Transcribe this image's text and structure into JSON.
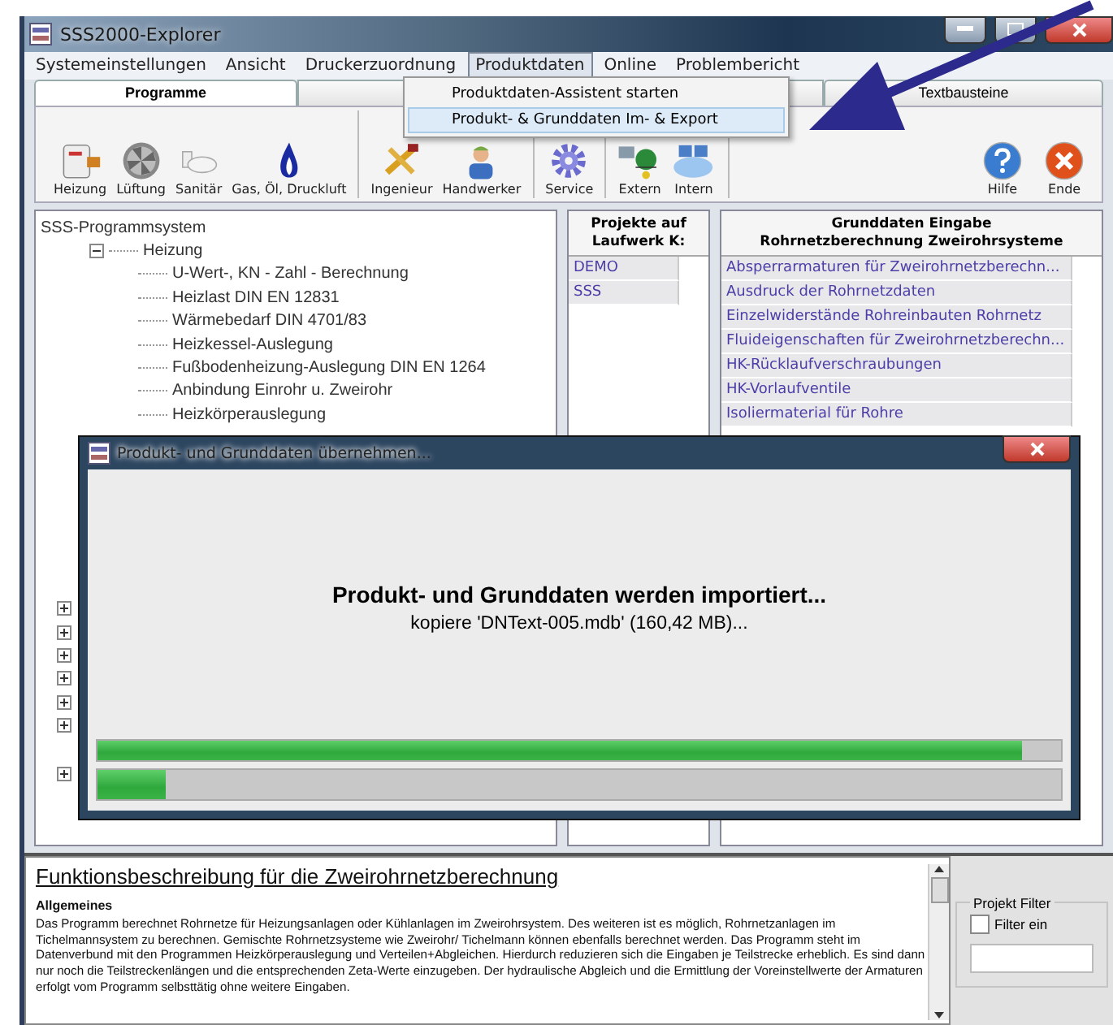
{
  "window": {
    "title": "SSS2000-Explorer"
  },
  "menu": [
    {
      "label": "Systemeinstellungen",
      "selected": false
    },
    {
      "label": "Ansicht",
      "selected": false
    },
    {
      "label": "Druckerzuordnung",
      "selected": false
    },
    {
      "label": "Produktdaten",
      "selected": true
    },
    {
      "label": "Online",
      "selected": false
    },
    {
      "label": "Problembericht",
      "selected": false
    }
  ],
  "dropdown": [
    {
      "label": "Produktdaten-Assistent starten",
      "selected": false
    },
    {
      "label": "Produkt- & Grunddaten Im- & Export",
      "selected": true
    }
  ],
  "tabs": [
    {
      "label": "Programme",
      "selected": true
    },
    {
      "label": "Textbausteine",
      "selected": false
    }
  ],
  "toolbar_groups": [
    [
      {
        "label": "Heizung"
      },
      {
        "label": "Lüftung"
      },
      {
        "label": "Sanitär"
      },
      {
        "label": "Gas, Öl, Druckluft"
      }
    ],
    [
      {
        "label": "Ingenieur"
      },
      {
        "label": "Handwerker"
      }
    ],
    [
      {
        "label": "Service"
      }
    ],
    [
      {
        "label": "Extern"
      },
      {
        "label": "Intern"
      }
    ]
  ],
  "toolbar_right": [
    {
      "label": "Hilfe"
    },
    {
      "label": "Ende"
    }
  ],
  "tree": {
    "label": "SSS-Programmsystem",
    "children": [
      {
        "label": "Heizung",
        "expanded": true,
        "children": [
          {
            "label": "U-Wert-, KN - Zahl - Berechnung"
          },
          {
            "label": "Heizlast DIN EN 12831"
          },
          {
            "label": "Wärmebedarf DIN 4701/83"
          },
          {
            "label": "Heizkessel-Auslegung"
          },
          {
            "label": "Fußbodenheizung-Auslegung DIN EN 1264"
          },
          {
            "label": "Anbindung Einrohr u. Zweirohr"
          },
          {
            "label": "Heizkörperauslegung"
          }
        ]
      }
    ]
  },
  "tree_collapsed_nodes": [
    {
      "expanded": false
    },
    {
      "expanded": false
    },
    {
      "expanded": false
    },
    {
      "expanded": false
    },
    {
      "expanded": false
    },
    {
      "expanded": false
    },
    {
      "expanded": false
    }
  ],
  "projects": {
    "header": "Projekte auf Laufwerk K:",
    "items": [
      "DEMO",
      "SSS"
    ]
  },
  "grunddaten": {
    "header_line_1": "Grunddaten Eingabe",
    "header_line_2": "Rohrnetzberechnung Zweirohrsysteme",
    "items": [
      "Absperrarmaturen für Zweirohrnetzberechn...",
      "Ausdruck der Rohrnetzdaten",
      "Einzelwiderstände Rohreinbauten Rohrnetz",
      "Fluideigenschaften für Zweirohrnetzberechn...",
      "HK-Rücklaufverschraubungen",
      "HK-Vorlaufventile",
      "Isoliermaterial für Rohre"
    ]
  },
  "dialog": {
    "title": "Produkt- und Grunddaten übernehmen...",
    "message": "Produkt- und Grunddaten werden importiert...",
    "detail": "kopiere 'DNText-005.mdb' (160,42 MB)...",
    "progress": [
      {
        "level": 0.96
      },
      {
        "level": 0.07
      }
    ]
  },
  "description": {
    "title": "Funktionsbeschreibung für die Zweirohrnetzberechnung",
    "section": "Allgemeines",
    "text": "Das Programm berechnet Rohrnetze für Heizungsanlagen oder Kühlanlagen im Zweirohrsystem. Des weiteren ist es möglich, Rohrnetzanlagen im Tichelmannsystem zu berechnen. Gemischte Rohrnetzsysteme wie Zweirohr/ Tichelmann können ebenfalls berechnet werden. Das Programm steht im Datenverbund mit den Programmen Heizkörperauslegung und Verteilen+Abgleichen. Hierdurch reduzieren sich die Eingaben je Teilstrecke erheblich. Es sind dann nur noch die Teilstreckenlängen und die entsprechenden Zeta-Werte einzugeben. Der hydraulische Abgleich und die Ermittlung der Voreinstellwerte der Armaturen erfolgt vom Programm selbsttätig ohne weitere Eingaben."
  },
  "filter": {
    "title": "Projekt Filter",
    "checkbox": {
      "label": "Filter ein",
      "checked": false
    }
  }
}
